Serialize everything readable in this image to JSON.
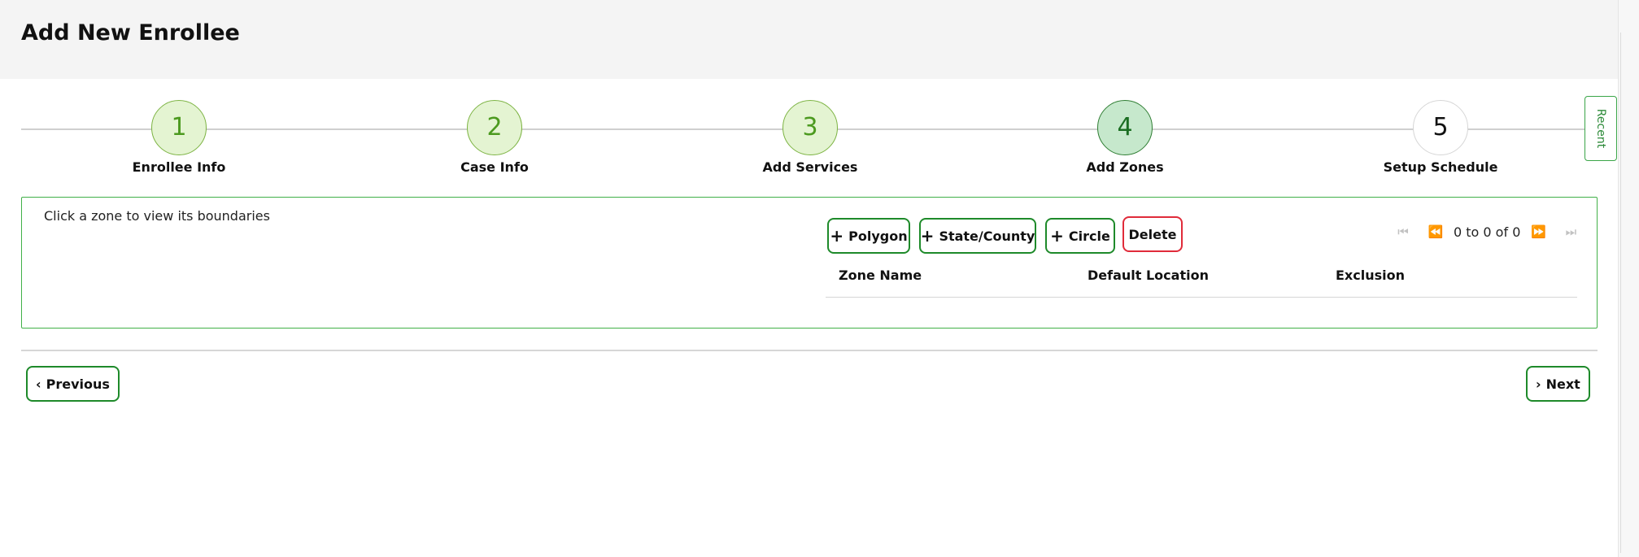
{
  "page": {
    "title": "Add New Enrollee"
  },
  "stepper": {
    "steps": [
      {
        "number": "1",
        "label": "Enrollee Info",
        "state": "completed"
      },
      {
        "number": "2",
        "label": "Case Info",
        "state": "completed"
      },
      {
        "number": "3",
        "label": "Add Services",
        "state": "completed"
      },
      {
        "number": "4",
        "label": "Add Zones",
        "state": "active"
      },
      {
        "number": "5",
        "label": "Setup Schedule",
        "state": "pending"
      }
    ]
  },
  "recent_tab": {
    "label": "Recent"
  },
  "zones": {
    "hint": "Click a zone to view its boundaries",
    "buttons": {
      "polygon": "Polygon",
      "state_county": "State/County",
      "circle": "Circle",
      "delete": "Delete"
    },
    "pager": {
      "text": "0 to 0 of 0",
      "icons": [
        "first-page-icon",
        "previous-page-icon",
        "next-page-icon",
        "last-page-icon"
      ]
    },
    "table": {
      "columns": [
        "Zone Name",
        "Default Location",
        "Exclusion"
      ],
      "rows": []
    }
  },
  "navigation": {
    "previous": "Previous",
    "next": "Next"
  },
  "colors": {
    "accent_green": "#1e8a2a",
    "step_complete_fill": "#e4f4d2",
    "step_active_fill": "#c6e8cc",
    "danger_red": "#e02b3a",
    "header_bg": "#f4f4f4"
  }
}
